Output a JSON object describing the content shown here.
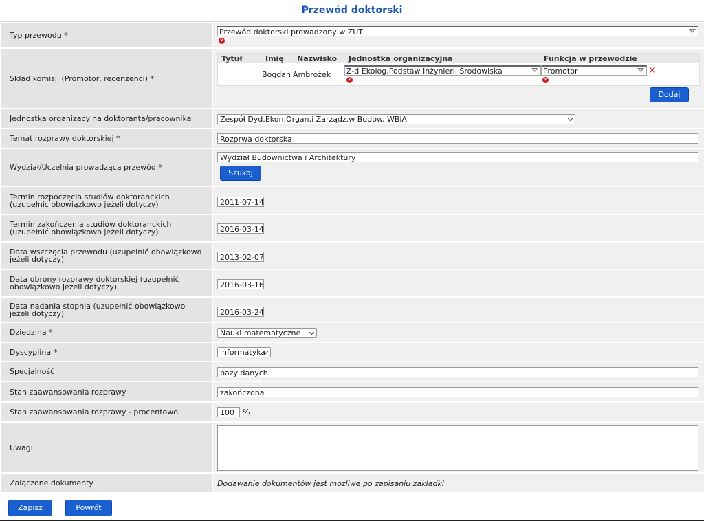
{
  "page_title": "Przewód doktorski",
  "fields": {
    "typ": {
      "label": "Typ przewodu *",
      "value": "Przewód doktorski prowadzony w ZUT"
    },
    "sklad": {
      "label": "Skład komisji (Promotor, recenzenci) *",
      "columns": [
        "Tytuł",
        "Imię",
        "Nazwisko",
        "Jednostka organizacyjna",
        "Funkcja w przewodzie"
      ],
      "rows": [
        {
          "tytul": "",
          "imie": "Bogdan",
          "nazwisko": "Ambrożek",
          "jednostka": "Z-d Ekolog.Podstaw Inżynierii Środowiska",
          "funkcja": "Promotor"
        }
      ],
      "add_button": "Dodaj"
    },
    "jednostka": {
      "label": "Jednostka organizacyjna doktoranta/pracownika",
      "value": "Zespół Dyd.Ekon.Organ.i Zarządz.w Budow. WBiA"
    },
    "temat": {
      "label": "Temat rozprawy doktorskiej *",
      "value": "Rozprwa doktorska"
    },
    "wydzial": {
      "label": "Wydział/Uczelnia prowadząca przewód *",
      "value": "Wydział Budownictwa i Architektury",
      "search_button": "Szukaj"
    },
    "termin_rozp": {
      "label": "Termin rozpoczęcia studiów doktoranckich (uzupełnić obowiązkowo jeżeli dotyczy)",
      "value": "2011-07-14"
    },
    "termin_zak": {
      "label": "Termin zakończenia studiów doktoranckich (uzupełnić obowiązkowo jeżeli dotyczy)",
      "value": "2016-03-14"
    },
    "data_wszcz": {
      "label": "Data wszczęcia przewodu (uzupełnić obowiązkowo jeżeli dotyczy)",
      "value": "2013-02-07"
    },
    "data_obrony": {
      "label": "Data obrony rozprawy doktorskiej (uzupełnić obowiązkowo jeżeli dotyczy)",
      "value": "2016-03-16"
    },
    "data_nadania": {
      "label": "Data nadania stopnia (uzupełnić obowiązkowo jeżeli dotyczy)",
      "value": "2016-03-24"
    },
    "dziedzina": {
      "label": "Dziedzina *",
      "value": "Nauki matematyczne"
    },
    "dyscyplina": {
      "label": "Dyscyplina *",
      "value": "informatyka"
    },
    "specjalnosc": {
      "label": "Specjalność",
      "value": "bazy danych"
    },
    "stan": {
      "label": "Stan zaawansowania rozprawy",
      "value": "zakończona"
    },
    "stan_proc": {
      "label": "Stan zaawansowania rozprawy - procentowo",
      "value": "100",
      "unit": "%"
    },
    "uwagi": {
      "label": "Uwagi",
      "value": ""
    },
    "zalaczone": {
      "label": "Załączone dokumenty",
      "value": "Dodawanie dokumentów jest możliwe po zapisaniu zakładki"
    }
  },
  "footer": {
    "save": "Zapisz",
    "back": "Powrót"
  },
  "colors": {
    "accent": "#1a5fd0",
    "title": "#1a55b5",
    "error": "#cc2222"
  }
}
